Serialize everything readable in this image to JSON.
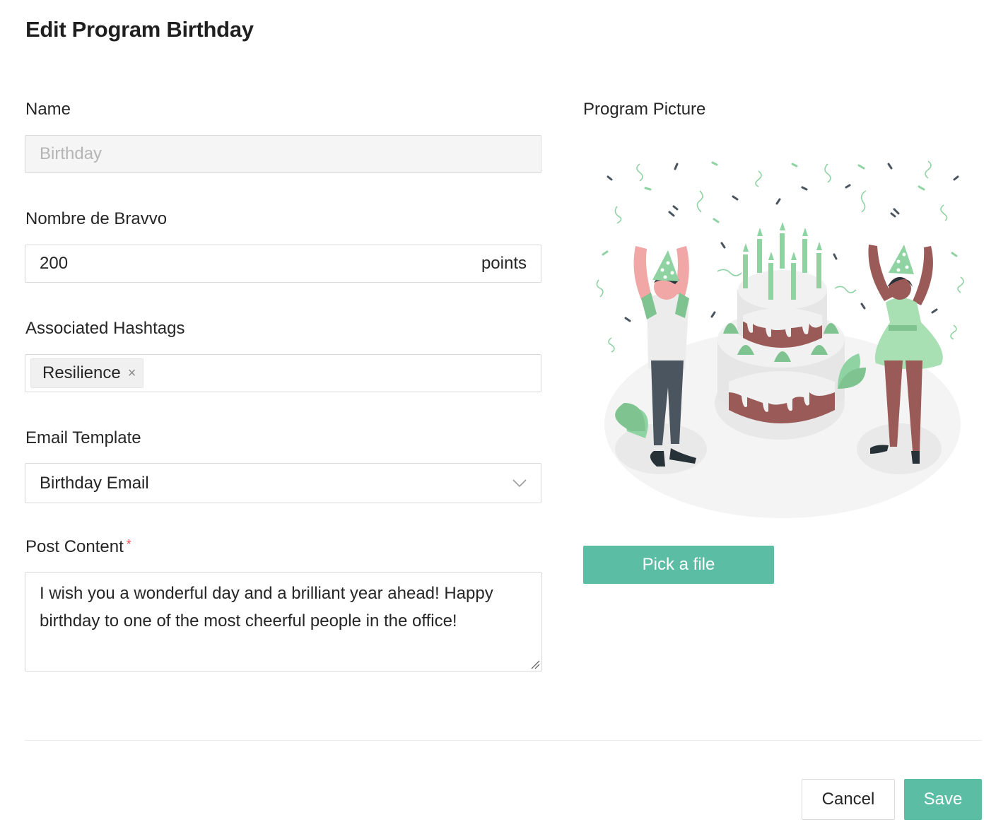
{
  "page": {
    "title": "Edit Program Birthday"
  },
  "form": {
    "name": {
      "label": "Name",
      "value": "Birthday"
    },
    "bravvo": {
      "label": "Nombre de Bravvo",
      "value": "200",
      "suffix": "points"
    },
    "hashtags": {
      "label": "Associated Hashtags",
      "tags": [
        "Resilience"
      ],
      "remove_glyph": "×"
    },
    "email_template": {
      "label": "Email Template",
      "value": "Birthday Email"
    },
    "post_content": {
      "label": "Post Content",
      "required_mark": "*",
      "value": "I wish you a wonderful day and a brilliant year ahead! Happy birthday to one of the most cheerful people in the office!"
    }
  },
  "picture": {
    "label": "Program Picture",
    "pick_label": "Pick a file"
  },
  "footer": {
    "cancel_label": "Cancel",
    "save_label": "Save"
  },
  "colors": {
    "accent": "#5bbda4",
    "required": "#ff4d4f",
    "illustration_green": "#8fd3a2",
    "cake_brown": "#9a5a57"
  },
  "icons": {
    "select": "chevron-down-icon",
    "textarea": "resize-handle-icon",
    "tag_remove": "close-icon"
  }
}
